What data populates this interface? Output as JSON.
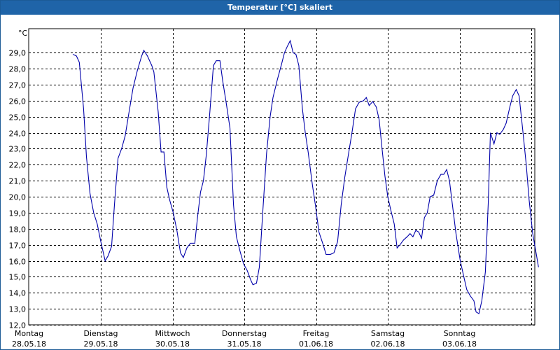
{
  "window": {
    "title": "Temperatur [°C] skaliert"
  },
  "chart_data": {
    "type": "line",
    "title": "Temperatur [°C] skaliert",
    "ylabel": "°C",
    "ylim": [
      12.0,
      30.5
    ],
    "yticks": [
      "12,0",
      "13,0",
      "14,0",
      "15,0",
      "16,0",
      "17,0",
      "18,0",
      "19,0",
      "20,0",
      "21,0",
      "22,0",
      "23,0",
      "24,0",
      "25,0",
      "26,0",
      "27,0",
      "28,0",
      "29,0"
    ],
    "xlim": [
      0,
      7
    ],
    "day_labels": [
      {
        "weekday": "Montag",
        "date": "28.05.18"
      },
      {
        "weekday": "Dienstag",
        "date": "29.05.18"
      },
      {
        "weekday": "Mittwoch",
        "date": "30.05.18"
      },
      {
        "weekday": "Donnerstag",
        "date": "31.05.18"
      },
      {
        "weekday": "Freitag",
        "date": "01.06.18"
      },
      {
        "weekday": "Samstag",
        "date": "02.06.18"
      },
      {
        "weekday": "Sonntag",
        "date": "03.06.18"
      }
    ],
    "grid": true,
    "series": [
      {
        "color": "#0000aa",
        "points": [
          [
            0.61,
            28.9
          ],
          [
            0.66,
            28.8
          ],
          [
            0.7,
            28.4
          ],
          [
            0.76,
            25.5
          ],
          [
            0.8,
            22.5
          ],
          [
            0.85,
            20.2
          ],
          [
            0.9,
            19.0
          ],
          [
            0.95,
            18.3
          ],
          [
            1.0,
            17.2
          ],
          [
            1.06,
            16.0
          ],
          [
            1.1,
            16.3
          ],
          [
            1.15,
            16.9
          ],
          [
            1.19,
            19.5
          ],
          [
            1.24,
            22.4
          ],
          [
            1.29,
            23.0
          ],
          [
            1.34,
            23.8
          ],
          [
            1.39,
            25.2
          ],
          [
            1.45,
            26.8
          ],
          [
            1.51,
            27.9
          ],
          [
            1.57,
            28.8
          ],
          [
            1.6,
            29.15
          ],
          [
            1.65,
            28.8
          ],
          [
            1.71,
            28.2
          ],
          [
            1.74,
            27.8
          ],
          [
            1.8,
            25.3
          ],
          [
            1.84,
            22.8
          ],
          [
            1.88,
            22.8
          ],
          [
            1.92,
            20.6
          ],
          [
            1.96,
            19.8
          ],
          [
            2.01,
            19.0
          ],
          [
            2.06,
            17.9
          ],
          [
            2.11,
            16.5
          ],
          [
            2.15,
            16.2
          ],
          [
            2.2,
            16.8
          ],
          [
            2.25,
            17.1
          ],
          [
            2.31,
            17.1
          ],
          [
            2.35,
            18.8
          ],
          [
            2.39,
            20.3
          ],
          [
            2.43,
            21.0
          ],
          [
            2.47,
            22.6
          ],
          [
            2.52,
            25.3
          ],
          [
            2.57,
            28.2
          ],
          [
            2.61,
            28.5
          ],
          [
            2.66,
            28.5
          ],
          [
            2.7,
            27.2
          ],
          [
            2.75,
            25.8
          ],
          [
            2.8,
            24.3
          ],
          [
            2.85,
            19.5
          ],
          [
            2.89,
            17.5
          ],
          [
            2.94,
            16.6
          ],
          [
            2.99,
            15.8
          ],
          [
            3.04,
            15.4
          ],
          [
            3.09,
            14.8
          ],
          [
            3.12,
            14.5
          ],
          [
            3.17,
            14.6
          ],
          [
            3.21,
            15.6
          ],
          [
            3.26,
            19.2
          ],
          [
            3.31,
            22.7
          ],
          [
            3.36,
            25.0
          ],
          [
            3.4,
            26.2
          ],
          [
            3.46,
            27.3
          ],
          [
            3.52,
            28.3
          ],
          [
            3.56,
            29.0
          ],
          [
            3.6,
            29.4
          ],
          [
            3.64,
            29.75
          ],
          [
            3.68,
            29.0
          ],
          [
            3.72,
            28.9
          ],
          [
            3.76,
            28.2
          ],
          [
            3.81,
            25.5
          ],
          [
            3.85,
            24.0
          ],
          [
            3.89,
            22.8
          ],
          [
            3.95,
            20.7
          ],
          [
            3.99,
            19.5
          ],
          [
            4.04,
            17.8
          ],
          [
            4.1,
            17.0
          ],
          [
            4.14,
            16.4
          ],
          [
            4.2,
            16.4
          ],
          [
            4.25,
            16.5
          ],
          [
            4.3,
            17.2
          ],
          [
            4.35,
            19.5
          ],
          [
            4.4,
            21.2
          ],
          [
            4.45,
            22.6
          ],
          [
            4.5,
            24.0
          ],
          [
            4.55,
            25.5
          ],
          [
            4.6,
            25.9
          ],
          [
            4.66,
            26.0
          ],
          [
            4.7,
            26.2
          ],
          [
            4.74,
            25.7
          ],
          [
            4.79,
            25.95
          ],
          [
            4.84,
            25.6
          ],
          [
            4.88,
            24.8
          ],
          [
            4.92,
            23.0
          ],
          [
            4.96,
            21.3
          ],
          [
            5.0,
            20.0
          ],
          [
            5.04,
            19.2
          ],
          [
            5.09,
            18.3
          ],
          [
            5.13,
            16.8
          ],
          [
            5.17,
            17.0
          ],
          [
            5.22,
            17.3
          ],
          [
            5.27,
            17.5
          ],
          [
            5.31,
            17.7
          ],
          [
            5.35,
            17.5
          ],
          [
            5.39,
            17.9
          ],
          [
            5.43,
            17.8
          ],
          [
            5.47,
            17.4
          ],
          [
            5.51,
            18.7
          ],
          [
            5.55,
            19.0
          ],
          [
            5.59,
            20.0
          ],
          [
            5.64,
            20.1
          ],
          [
            5.69,
            21.0
          ],
          [
            5.74,
            21.4
          ],
          [
            5.78,
            21.4
          ],
          [
            5.82,
            21.7
          ],
          [
            5.86,
            21.0
          ],
          [
            5.9,
            19.5
          ],
          [
            5.95,
            17.7
          ],
          [
            6.01,
            16.0
          ],
          [
            6.06,
            15.0
          ],
          [
            6.1,
            14.2
          ],
          [
            6.15,
            13.8
          ],
          [
            6.2,
            13.5
          ],
          [
            6.23,
            12.8
          ],
          [
            6.27,
            12.7
          ],
          [
            6.31,
            13.5
          ],
          [
            6.36,
            15.3
          ],
          [
            6.4,
            19.6
          ],
          [
            6.43,
            24.0
          ],
          [
            6.48,
            23.3
          ],
          [
            6.52,
            24.0
          ],
          [
            6.56,
            23.9
          ],
          [
            6.61,
            24.2
          ],
          [
            6.65,
            24.6
          ],
          [
            6.7,
            25.6
          ],
          [
            6.74,
            26.3
          ],
          [
            6.79,
            26.7
          ],
          [
            6.83,
            26.3
          ],
          [
            6.88,
            24.2
          ],
          [
            6.93,
            22.0
          ],
          [
            6.97,
            19.8
          ],
          [
            7.02,
            17.7
          ],
          [
            7.07,
            16.4
          ],
          [
            7.1,
            15.6
          ]
        ]
      }
    ]
  }
}
